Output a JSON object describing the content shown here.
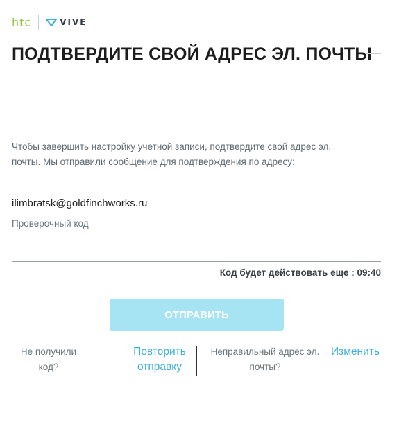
{
  "brand": {
    "htc": "htc",
    "vive": "VIVE"
  },
  "page": {
    "title": "ПОДТВЕРДИТЕ СВОЙ АДРЕС ЭЛ. ПОЧТЫ",
    "description_line1": "Чтобы завершить настройку учетной записи, подтвердите свой адрес эл.",
    "description_line2": "почты. Мы отправили сообщение для подтверждения по адресу:",
    "email": "ilimbratsk@goldfinchworks.ru",
    "code_label": "Проверочный код",
    "code_value": "",
    "timer_text": "Код будет действовать еще : 09:40"
  },
  "actions": {
    "submit_label": "ОТПРАВИТЬ",
    "not_received_line1": "Не получили",
    "not_received_line2": "код?",
    "resend_line1": "Повторить",
    "resend_line2": "отправку",
    "wrong_email_line1": "Неправильный адрес эл.",
    "wrong_email_line2": "почты?",
    "change_label": "Изменить"
  },
  "colors": {
    "htc_green": "#8dc63f",
    "link_blue": "#3bb0dc",
    "button_disabled": "#a6e3f3"
  }
}
